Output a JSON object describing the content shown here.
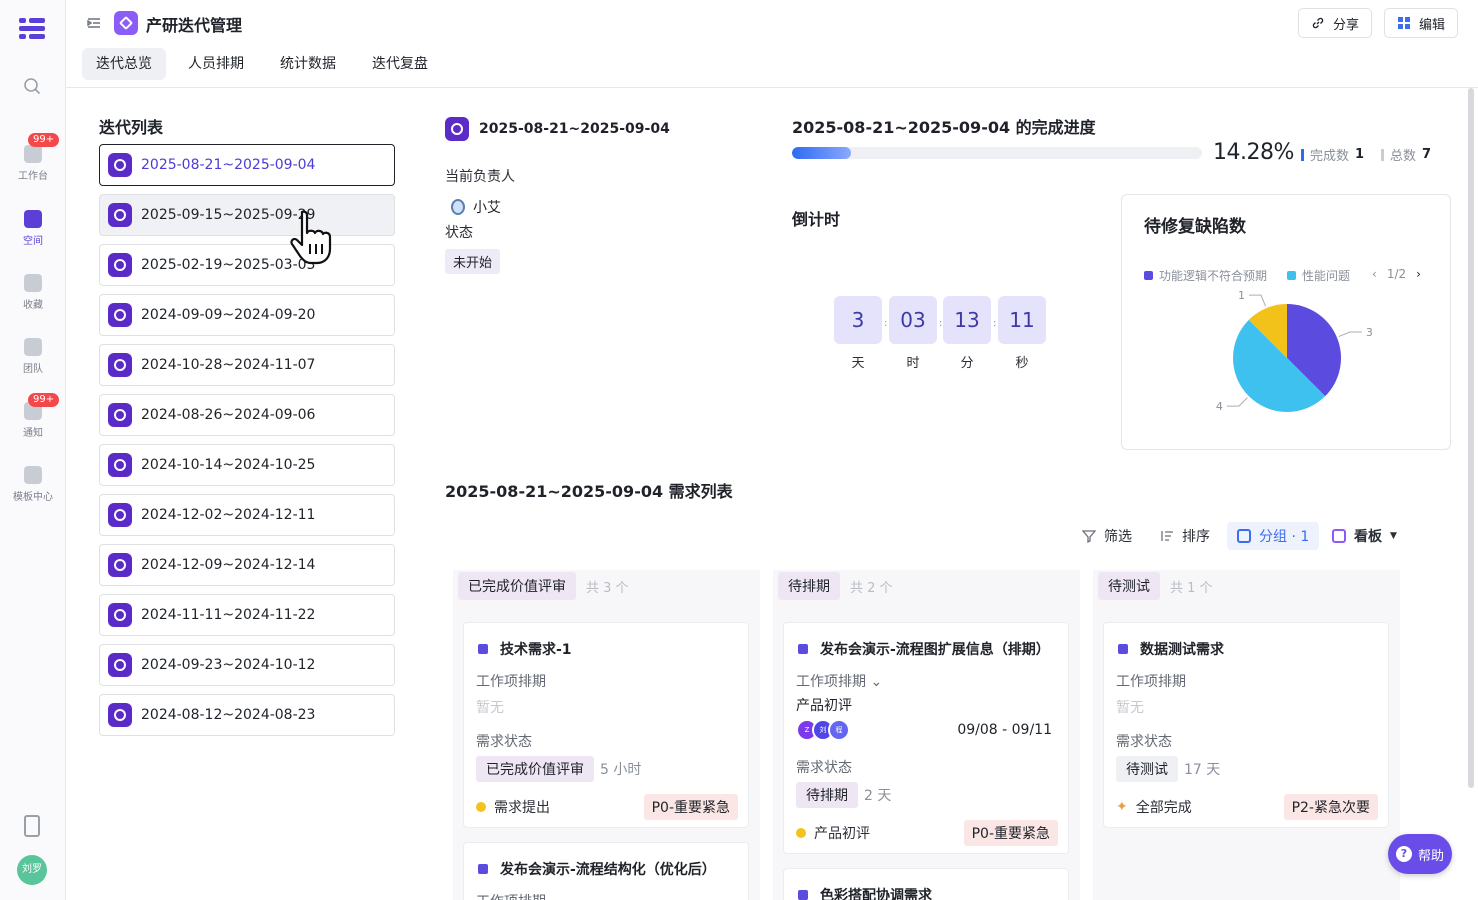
{
  "rail": {
    "items": [
      {
        "label": "工作台",
        "badge": "99+"
      },
      {
        "label": "空间"
      },
      {
        "label": "收藏"
      },
      {
        "label": "团队"
      },
      {
        "label": "通知",
        "badge": "99+"
      },
      {
        "label": "模板中心"
      }
    ],
    "search_icon": "search-icon",
    "user_initials": "刘罗"
  },
  "header": {
    "title": "产研迭代管理",
    "share_label": "分享",
    "edit_label": "编辑",
    "tabs": [
      "迭代总览",
      "人员排期",
      "统计数据",
      "迭代复盘"
    ],
    "active_tab": "迭代总览"
  },
  "iterations": {
    "title": "迭代列表",
    "items": [
      "2025-08-21~2025-09-04",
      "2025-09-15~2025-09-29",
      "2025-02-19~2025-03-03",
      "2024-09-09~2024-09-20",
      "2024-10-28~2024-11-07",
      "2024-08-26~2024-09-06",
      "2024-10-14~2024-10-25",
      "2024-12-02~2024-12-11",
      "2024-12-09~2024-12-14",
      "2024-11-11~2024-11-22",
      "2024-09-23~2024-10-12",
      "2024-08-12~2024-08-23"
    ],
    "selected": "2025-08-21~2025-09-04"
  },
  "detail": {
    "name": "2025-08-21~2025-09-04",
    "owner_label": "当前负责人",
    "owner": "小艾",
    "status_label": "状态",
    "status": "未开始"
  },
  "progress": {
    "title": "2025-08-21~2025-09-04 的完成进度",
    "percent_text": "14.28%",
    "fraction": 0.1428,
    "done_label": "完成数",
    "done": "1",
    "total_label": "总数",
    "total": "7",
    "color": "#2e6bf0"
  },
  "countdown": {
    "title": "倒计时",
    "units": [
      {
        "value": "3",
        "unit": "天"
      },
      {
        "value": "03",
        "unit": "时"
      },
      {
        "value": "13",
        "unit": "分"
      },
      {
        "value": "11",
        "unit": "秒"
      }
    ]
  },
  "defects": {
    "title": "待修复缺陷数",
    "legend": [
      {
        "name": "功能逻辑不符合预期",
        "color": "#5b4bde"
      },
      {
        "name": "性能问题",
        "color": "#3ec1ef"
      }
    ],
    "pager": "1/2",
    "chart_data": {
      "type": "pie",
      "slices": [
        {
          "label": "3",
          "value": 3,
          "color": "#5b4bde"
        },
        {
          "label": "4",
          "value": 4,
          "color": "#3ec1ef"
        },
        {
          "label": "1",
          "value": 1,
          "color": "#f2c21b"
        }
      ]
    }
  },
  "requirements": {
    "title": "2025-08-21~2025-09-04 需求列表",
    "toolbar": {
      "filter": "筛选",
      "sort": "排序",
      "group": "分组 · 1",
      "view": "看板"
    },
    "columns": [
      {
        "name": "已完成价值评审",
        "count": "共 3 个",
        "cards": [
          {
            "title": "技术需求-1",
            "schedule_label": "工作项排期",
            "schedule_value": "暂无",
            "state_label": "需求状态",
            "state": "已完成价值评审",
            "duration": "5 小时",
            "node": "需求提出",
            "priority": "P0-重要紧急"
          },
          {
            "title": "发布会演示-流程结构化（优化后）",
            "schedule_label": "工作项排期"
          }
        ]
      },
      {
        "name": "待排期",
        "count": "共 2 个",
        "cards": [
          {
            "title": "发布会演示-流程图扩展信息（排期）",
            "schedule_label": "工作项排期",
            "sub_label": "产品初评",
            "date_range": "09/08 - 09/11",
            "state_label": "需求状态",
            "state": "待排期",
            "duration": "2 天",
            "node": "产品初评",
            "priority": "P0-重要紧急"
          },
          {
            "title": "色彩搭配协调需求"
          }
        ]
      },
      {
        "name": "待测试",
        "count": "共 1 个",
        "cards": [
          {
            "title": "数据测试需求",
            "schedule_label": "工作项排期",
            "schedule_value": "暂无",
            "state_label": "需求状态",
            "state": "待测试",
            "duration": "17 天",
            "node": "全部完成",
            "priority": "P2-紧急次要"
          }
        ]
      }
    ]
  },
  "help_label": "帮助"
}
